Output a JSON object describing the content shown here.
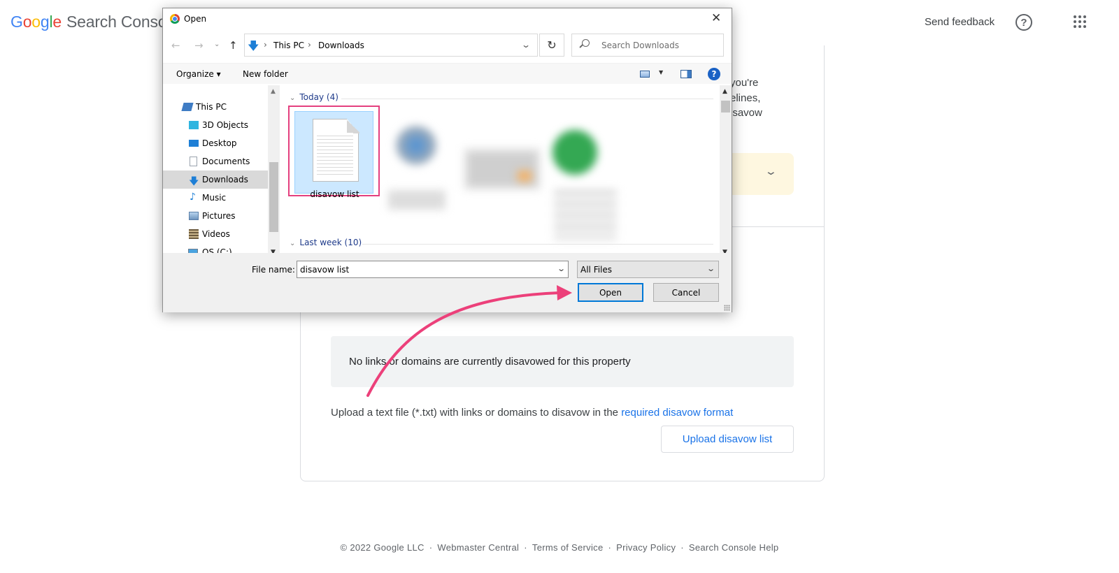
{
  "header": {
    "logo_google": [
      "G",
      "o",
      "o",
      "g",
      "l",
      "e"
    ],
    "logo_product": "Search Console",
    "send_feedback": "Send feedback",
    "help_icon": "help-circle-icon",
    "apps_icon": "apps-grid-icon"
  },
  "card": {
    "intro_fragment": [
      "you're",
      "elines,",
      "isavow"
    ],
    "warning_chevron": "⌄",
    "status_text": "No links or domains are currently disavowed for this property",
    "upload_desc_prefix": "Upload a text file (*.txt) with links or domains to disavow in the ",
    "upload_desc_link": "required disavow format",
    "upload_button": "Upload disavow list"
  },
  "footer": {
    "items": [
      "© 2022 Google LLC",
      "Webmaster Central",
      "Terms of Service",
      "Privacy Policy",
      "Search Console Help"
    ],
    "separator": "·"
  },
  "dialog": {
    "title": "Open",
    "close": "✕",
    "nav": {
      "back": "←",
      "forward": "→",
      "recent": "⌄",
      "up": "↑",
      "refresh": "↻"
    },
    "address": {
      "crumbs": [
        "This PC",
        "Downloads"
      ],
      "separator": "›",
      "dropdown": "⌄"
    },
    "search_placeholder": "Search Downloads",
    "toolbar": {
      "organize": "Organize ▾",
      "new_folder": "New folder",
      "view_dropdown": "▼",
      "help": "?"
    },
    "sidebar": [
      {
        "label": "This PC",
        "icon": "computer-icon",
        "color": "#3f7cc4"
      },
      {
        "label": "3D Objects",
        "icon": "cube-icon",
        "color": "#2fb5e0"
      },
      {
        "label": "Desktop",
        "icon": "desktop-icon",
        "color": "#1e7fd6"
      },
      {
        "label": "Documents",
        "icon": "documents-icon",
        "color": "#9aa3ad"
      },
      {
        "label": "Downloads",
        "icon": "download-arrow-icon",
        "color": "#1e7fd6",
        "selected": true
      },
      {
        "label": "Music",
        "icon": "music-note-icon",
        "color": "#1e7fd6"
      },
      {
        "label": "Pictures",
        "icon": "pictures-icon",
        "color": "#5a7fa8"
      },
      {
        "label": "Videos",
        "icon": "film-icon",
        "color": "#6b5a3e"
      },
      {
        "label": "OS (C:)",
        "icon": "drive-icon",
        "color": "#4aa3df"
      }
    ],
    "groups": [
      {
        "label": "Today (4)",
        "chevron": "⌄"
      },
      {
        "label": "Last week (10)",
        "chevron": "⌄"
      }
    ],
    "selected_file": {
      "name": "disavow list",
      "icon": "text-document-icon"
    },
    "filename_label": "File name:",
    "filename_value": "disavow list",
    "filter_value": "All Files",
    "open_button": "Open",
    "cancel_button": "Cancel"
  },
  "colors": {
    "highlight_border": "#e4407f",
    "annotation_arrow": "#ec407a",
    "link": "#1a73e8",
    "selected_tile": "#cce8ff"
  }
}
